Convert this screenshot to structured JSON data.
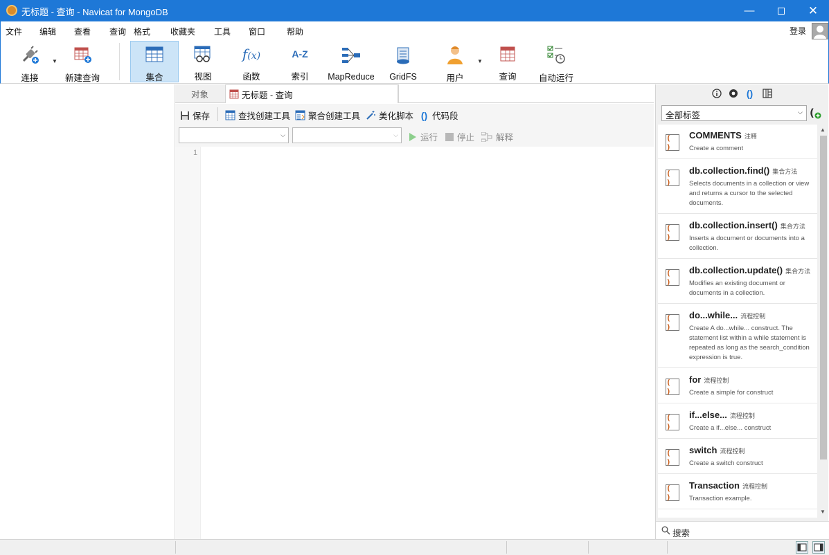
{
  "window": {
    "title": "无标题 - 查询 - Navicat for MongoDB"
  },
  "menu": [
    "文件",
    "编辑",
    "查看",
    "查询",
    "格式",
    "收藏夹",
    "工具",
    "窗口",
    "帮助"
  ],
  "login_label": "登录",
  "toolbar": {
    "connect": "连接",
    "new_query": "新建查询",
    "collection": "集合",
    "view": "视图",
    "function": "函数",
    "index": "索引",
    "mapreduce": "MapReduce",
    "gridfs": "GridFS",
    "user": "用户",
    "query": "查询",
    "auto_run": "自动运行"
  },
  "tabs": {
    "objects": "对象",
    "query_tab": "无标题 - 查询"
  },
  "editor_toolbar": {
    "save": "保存",
    "find_builder": "查找创建工具",
    "aggregate_builder": "聚合创建工具",
    "beautify": "美化脚本",
    "snippets": "代码段"
  },
  "run_toolbar": {
    "run": "运行",
    "stop": "停止",
    "explain": "解释"
  },
  "editor": {
    "line_number": "1"
  },
  "right_panel": {
    "tag_filter": "全部标签",
    "snippets": [
      {
        "name": "COMMENTS",
        "category": "注释",
        "desc": "Create a comment"
      },
      {
        "name": "db.collection.find()",
        "category": "集合方法",
        "desc": "Selects documents in a collection or view and returns a cursor to the selected documents."
      },
      {
        "name": "db.collection.insert()",
        "category": "集合方法",
        "desc": "Inserts a document or documents into a collection."
      },
      {
        "name": "db.collection.update()",
        "category": "集合方法",
        "desc": "Modifies an existing document or documents in a collection."
      },
      {
        "name": "do...while...",
        "category": "流程控制",
        "desc": "Create A do...while... construct. The statement list within a while statement is repeated as long as the search_condition expression is true."
      },
      {
        "name": "for",
        "category": "流程控制",
        "desc": "Create a simple for construct"
      },
      {
        "name": "if...else...",
        "category": "流程控制",
        "desc": "Create a if...else... construct"
      },
      {
        "name": "switch",
        "category": "流程控制",
        "desc": "Create a switch construct"
      },
      {
        "name": "Transaction",
        "category": "流程控制",
        "desc": "Transaction example."
      }
    ],
    "search_placeholder": "搜索"
  },
  "colors": {
    "titlebar": "#1e78d7",
    "active_tool": "#cce4f7",
    "snippet_icon": "#c65a16"
  }
}
